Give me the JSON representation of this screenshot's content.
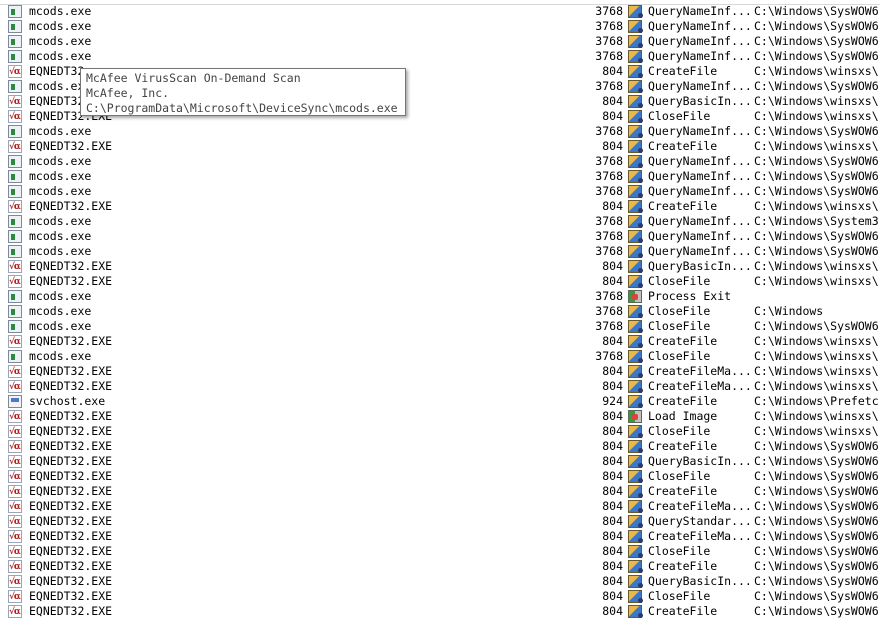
{
  "events": [
    {
      "process": "mcods.exe",
      "icon": "mcods",
      "pid": "3768",
      "operation": "QueryNameInf...",
      "op_icon": "filesystem",
      "path": "C:\\Windows\\SysWOW6"
    },
    {
      "process": "mcods.exe",
      "icon": "mcods",
      "pid": "3768",
      "operation": "QueryNameInf...",
      "op_icon": "filesystem",
      "path": "C:\\Windows\\SysWOW6"
    },
    {
      "process": "mcods.exe",
      "icon": "mcods",
      "pid": "3768",
      "operation": "QueryNameInf...",
      "op_icon": "filesystem",
      "path": "C:\\Windows\\SysWOW6"
    },
    {
      "process": "mcods.exe",
      "icon": "mcods",
      "pid": "3768",
      "operation": "QueryNameInf...",
      "op_icon": "filesystem",
      "path": "C:\\Windows\\SysWOW6"
    },
    {
      "process": "EQNEDT32",
      "icon": "eqnedt",
      "pid": "804",
      "operation": "CreateFile",
      "op_icon": "filesystem",
      "path": "C:\\Windows\\winsxs\\"
    },
    {
      "process": "mcods.ex",
      "icon": "mcods",
      "pid": "3768",
      "operation": "QueryNameInf...",
      "op_icon": "filesystem",
      "path": "C:\\Windows\\SysWOW6"
    },
    {
      "process": "EQNEDT32",
      "icon": "eqnedt",
      "pid": "804",
      "operation": "QueryBasicIn...",
      "op_icon": "filesystem",
      "path": "C:\\Windows\\winsxs\\"
    },
    {
      "process": "EQNEDT32.EXE",
      "icon": "eqnedt",
      "pid": "804",
      "operation": "CloseFile",
      "op_icon": "filesystem",
      "path": "C:\\Windows\\winsxs\\"
    },
    {
      "process": "mcods.exe",
      "icon": "mcods",
      "pid": "3768",
      "operation": "QueryNameInf...",
      "op_icon": "filesystem",
      "path": "C:\\Windows\\SysWOW6"
    },
    {
      "process": "EQNEDT32.EXE",
      "icon": "eqnedt",
      "pid": "804",
      "operation": "CreateFile",
      "op_icon": "filesystem",
      "path": "C:\\Windows\\winsxs\\"
    },
    {
      "process": "mcods.exe",
      "icon": "mcods",
      "pid": "3768",
      "operation": "QueryNameInf...",
      "op_icon": "filesystem",
      "path": "C:\\Windows\\SysWOW6"
    },
    {
      "process": "mcods.exe",
      "icon": "mcods",
      "pid": "3768",
      "operation": "QueryNameInf...",
      "op_icon": "filesystem",
      "path": "C:\\Windows\\SysWOW6"
    },
    {
      "process": "mcods.exe",
      "icon": "mcods",
      "pid": "3768",
      "operation": "QueryNameInf...",
      "op_icon": "filesystem",
      "path": "C:\\Windows\\SysWOW6"
    },
    {
      "process": "EQNEDT32.EXE",
      "icon": "eqnedt",
      "pid": "804",
      "operation": "CreateFile",
      "op_icon": "filesystem",
      "path": "C:\\Windows\\winsxs\\"
    },
    {
      "process": "mcods.exe",
      "icon": "mcods",
      "pid": "3768",
      "operation": "QueryNameInf...",
      "op_icon": "filesystem",
      "path": "C:\\Windows\\System3"
    },
    {
      "process": "mcods.exe",
      "icon": "mcods",
      "pid": "3768",
      "operation": "QueryNameInf...",
      "op_icon": "filesystem",
      "path": "C:\\Windows\\SysWOW6"
    },
    {
      "process": "mcods.exe",
      "icon": "mcods",
      "pid": "3768",
      "operation": "QueryNameInf...",
      "op_icon": "filesystem",
      "path": "C:\\Windows\\SysWOW6"
    },
    {
      "process": "EQNEDT32.EXE",
      "icon": "eqnedt",
      "pid": "804",
      "operation": "QueryBasicIn...",
      "op_icon": "filesystem",
      "path": "C:\\Windows\\winsxs\\"
    },
    {
      "process": "EQNEDT32.EXE",
      "icon": "eqnedt",
      "pid": "804",
      "operation": "CloseFile",
      "op_icon": "filesystem",
      "path": "C:\\Windows\\winsxs\\"
    },
    {
      "process": "mcods.exe",
      "icon": "mcods",
      "pid": "3768",
      "operation": "Process Exit",
      "op_icon": "process",
      "path": ""
    },
    {
      "process": "mcods.exe",
      "icon": "mcods",
      "pid": "3768",
      "operation": "CloseFile",
      "op_icon": "filesystem",
      "path": "C:\\Windows"
    },
    {
      "process": "mcods.exe",
      "icon": "mcods",
      "pid": "3768",
      "operation": "CloseFile",
      "op_icon": "filesystem",
      "path": "C:\\Windows\\SysWOW6"
    },
    {
      "process": "EQNEDT32.EXE",
      "icon": "eqnedt",
      "pid": "804",
      "operation": "CreateFile",
      "op_icon": "filesystem",
      "path": "C:\\Windows\\winsxs\\"
    },
    {
      "process": "mcods.exe",
      "icon": "mcods",
      "pid": "3768",
      "operation": "CloseFile",
      "op_icon": "filesystem",
      "path": "C:\\Windows\\winsxs\\"
    },
    {
      "process": "EQNEDT32.EXE",
      "icon": "eqnedt",
      "pid": "804",
      "operation": "CreateFileMa...",
      "op_icon": "filesystem",
      "path": "C:\\Windows\\winsxs\\"
    },
    {
      "process": "EQNEDT32.EXE",
      "icon": "eqnedt",
      "pid": "804",
      "operation": "CreateFileMa...",
      "op_icon": "filesystem",
      "path": "C:\\Windows\\winsxs\\"
    },
    {
      "process": "svchost.exe",
      "icon": "svchost",
      "pid": "924",
      "operation": "CreateFile",
      "op_icon": "filesystem",
      "path": "C:\\Windows\\Prefetc"
    },
    {
      "process": "EQNEDT32.EXE",
      "icon": "eqnedt",
      "pid": "804",
      "operation": "Load Image",
      "op_icon": "process",
      "path": "C:\\Windows\\winsxs\\"
    },
    {
      "process": "EQNEDT32.EXE",
      "icon": "eqnedt",
      "pid": "804",
      "operation": "CloseFile",
      "op_icon": "filesystem",
      "path": "C:\\Windows\\winsxs\\"
    },
    {
      "process": "EQNEDT32.EXE",
      "icon": "eqnedt",
      "pid": "804",
      "operation": "CreateFile",
      "op_icon": "filesystem",
      "path": "C:\\Windows\\SysWOW6"
    },
    {
      "process": "EQNEDT32.EXE",
      "icon": "eqnedt",
      "pid": "804",
      "operation": "QueryBasicIn...",
      "op_icon": "filesystem",
      "path": "C:\\Windows\\SysWOW6"
    },
    {
      "process": "EQNEDT32.EXE",
      "icon": "eqnedt",
      "pid": "804",
      "operation": "CloseFile",
      "op_icon": "filesystem",
      "path": "C:\\Windows\\SysWOW6"
    },
    {
      "process": "EQNEDT32.EXE",
      "icon": "eqnedt",
      "pid": "804",
      "operation": "CreateFile",
      "op_icon": "filesystem",
      "path": "C:\\Windows\\SysWOW6"
    },
    {
      "process": "EQNEDT32.EXE",
      "icon": "eqnedt",
      "pid": "804",
      "operation": "CreateFileMa...",
      "op_icon": "filesystem",
      "path": "C:\\Windows\\SysWOW6"
    },
    {
      "process": "EQNEDT32.EXE",
      "icon": "eqnedt",
      "pid": "804",
      "operation": "QueryStandar...",
      "op_icon": "filesystem",
      "path": "C:\\Windows\\SysWOW6"
    },
    {
      "process": "EQNEDT32.EXE",
      "icon": "eqnedt",
      "pid": "804",
      "operation": "CreateFileMa...",
      "op_icon": "filesystem",
      "path": "C:\\Windows\\SysWOW6"
    },
    {
      "process": "EQNEDT32.EXE",
      "icon": "eqnedt",
      "pid": "804",
      "operation": "CloseFile",
      "op_icon": "filesystem",
      "path": "C:\\Windows\\SysWOW6"
    },
    {
      "process": "EQNEDT32.EXE",
      "icon": "eqnedt",
      "pid": "804",
      "operation": "CreateFile",
      "op_icon": "filesystem",
      "path": "C:\\Windows\\SysWOW6"
    },
    {
      "process": "EQNEDT32.EXE",
      "icon": "eqnedt",
      "pid": "804",
      "operation": "QueryBasicIn...",
      "op_icon": "filesystem",
      "path": "C:\\Windows\\SysWOW6"
    },
    {
      "process": "EQNEDT32.EXE",
      "icon": "eqnedt",
      "pid": "804",
      "operation": "CloseFile",
      "op_icon": "filesystem",
      "path": "C:\\Windows\\SysWOW6"
    },
    {
      "process": "EQNEDT32.EXE",
      "icon": "eqnedt",
      "pid": "804",
      "operation": "CreateFile",
      "op_icon": "filesystem",
      "path": "C:\\Windows\\SysWOW6"
    }
  ],
  "tooltip": {
    "line1": "McAfee VirusScan On-Demand Scan",
    "line2": "McAfee, Inc.",
    "line3": "C:\\ProgramData\\Microsoft\\DeviceSync\\mcods.exe"
  }
}
